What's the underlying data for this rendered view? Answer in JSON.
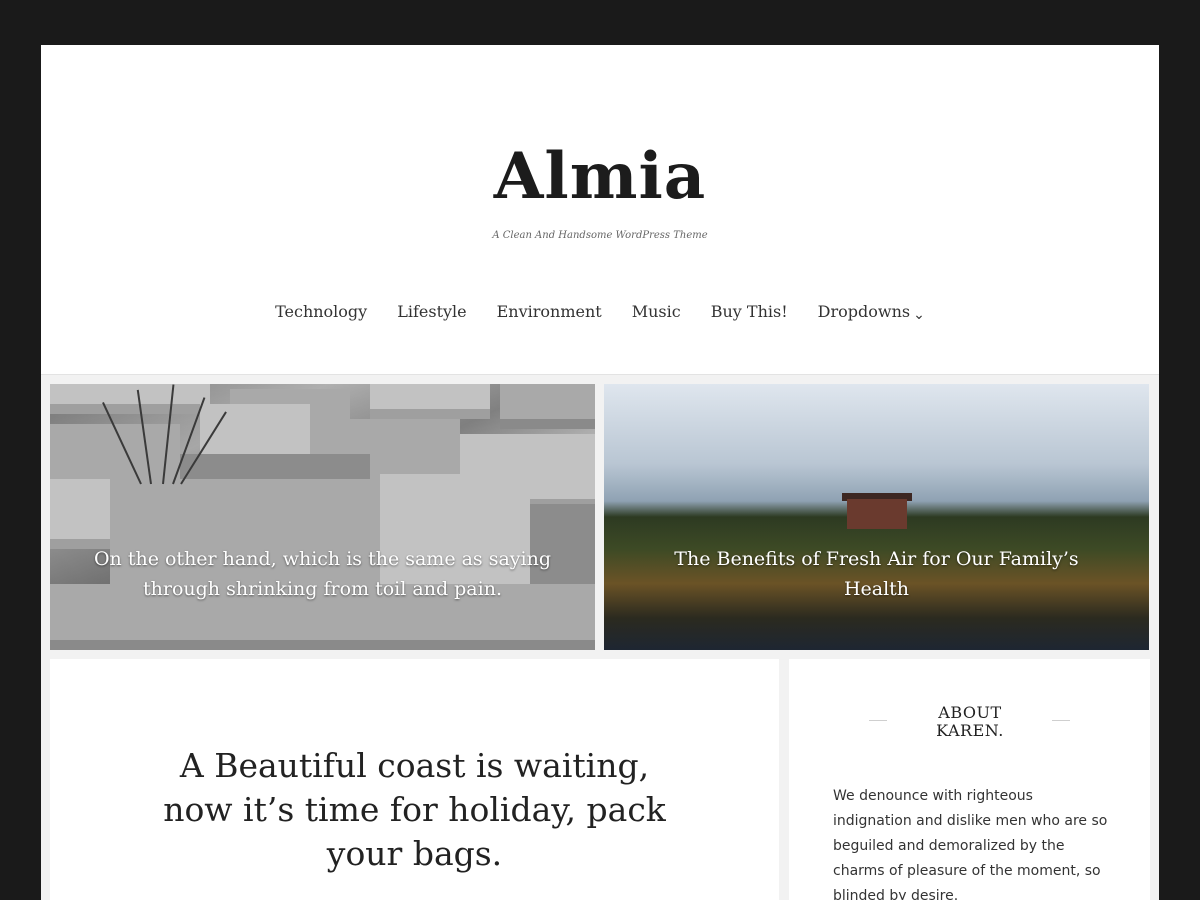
{
  "site": {
    "title": "Almia",
    "tagline": "A Clean And Handsome WordPress Theme"
  },
  "nav": {
    "items": [
      "Technology",
      "Lifestyle",
      "Environment",
      "Music",
      "Buy This!",
      "Dropdowns"
    ],
    "dropdown_icon": "chevron-down-icon"
  },
  "featured": [
    {
      "title": "On the other hand, which is the same as saying through shrinking from toil and pain."
    },
    {
      "title": "The Benefits of Fresh Air for Our Family’s Health"
    }
  ],
  "main_post": {
    "title": "A Beautiful coast is waiting, now it’s time for holiday, pack your bags."
  },
  "sidebar": {
    "widget_title": "ABOUT KAREN.",
    "widget_text": "We denounce with righteous indignation and dislike men who are so beguiled and demoralized by the charms of pleasure of the moment, so blinded by desire."
  },
  "colors": {
    "frame": "#1a1a1a",
    "header_bg": "#ffffff",
    "content_bg": "#f2f2f2",
    "text": "#222222"
  }
}
